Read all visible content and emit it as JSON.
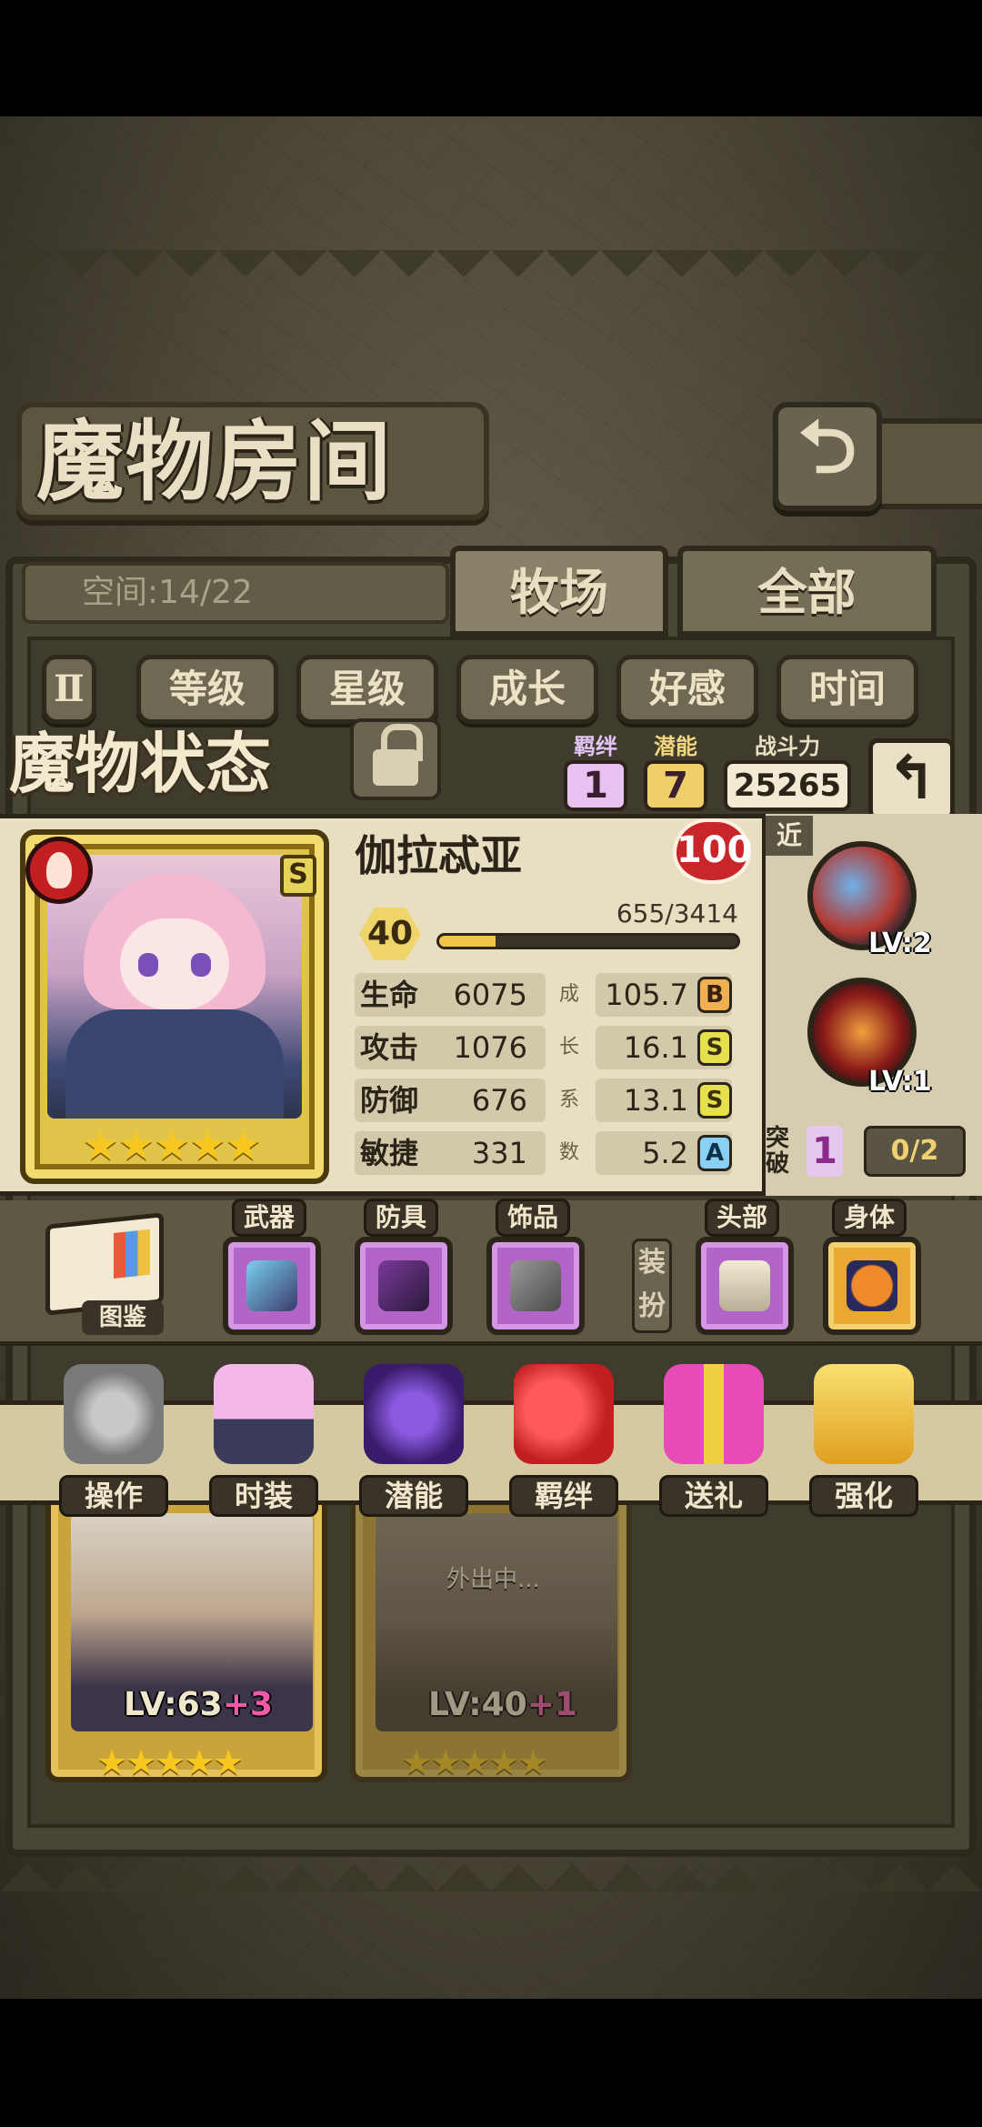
{
  "screen": {
    "room_title": "魔物房间",
    "capacity_text": "空间:14/22",
    "tabs": [
      {
        "label": "牧场",
        "active": true
      },
      {
        "label": "全部",
        "active": false
      }
    ],
    "sort_buttons": [
      "等级",
      "星级",
      "成长",
      "好感",
      "时间"
    ],
    "sort_toggle_glyph": "Ⅱ",
    "back_glyph": "⮌"
  },
  "status": {
    "title": "魔物状态",
    "bond_label": "羁绊",
    "bond_value": "1",
    "potential_label": "潜能",
    "potential_value": "7",
    "power_label": "战斗力",
    "power_value": "25265",
    "return_glyph": "↰"
  },
  "monster": {
    "name": "伽拉忒亚",
    "affection": "100",
    "level": "40",
    "xp_text": "655/3414",
    "xp_fraction": 0.19,
    "grade": "S",
    "star_count": 5,
    "stars": "★★★★★",
    "growth_side_label": [
      "成",
      "长",
      "系",
      "数"
    ],
    "stats": [
      {
        "name": "生命",
        "value": "6075",
        "growth": "105.7",
        "grade": "B"
      },
      {
        "name": "攻击",
        "value": "1076",
        "growth": "16.1",
        "grade": "S"
      },
      {
        "name": "防御",
        "value": "676",
        "growth": "13.1",
        "grade": "S"
      },
      {
        "name": "敏捷",
        "value": "331",
        "growth": "5.2",
        "grade": "A"
      }
    ]
  },
  "skills": {
    "range": "近",
    "items": [
      {
        "level": "LV:2"
      },
      {
        "level": "LV:1"
      }
    ],
    "breakthrough_label": "突破",
    "breakthrough_count": "1",
    "breakthrough_progress": "0/2"
  },
  "equipment": {
    "codex_label": "图鉴",
    "slots": [
      {
        "label": "武器"
      },
      {
        "label": "防具"
      },
      {
        "label": "饰品"
      }
    ],
    "dress_label": "装扮",
    "dress_slots": [
      {
        "label": "头部"
      },
      {
        "label": "身体"
      }
    ]
  },
  "actions": [
    "操作",
    "时装",
    "潜能",
    "羁绊",
    "送礼",
    "强化"
  ],
  "roster": [
    {
      "level": "LV:63",
      "plus": "+3",
      "stars": "★★★★★",
      "status": ""
    },
    {
      "level": "LV:40",
      "plus": "+1",
      "stars": "★★★★★",
      "status": "外出中..."
    }
  ]
}
